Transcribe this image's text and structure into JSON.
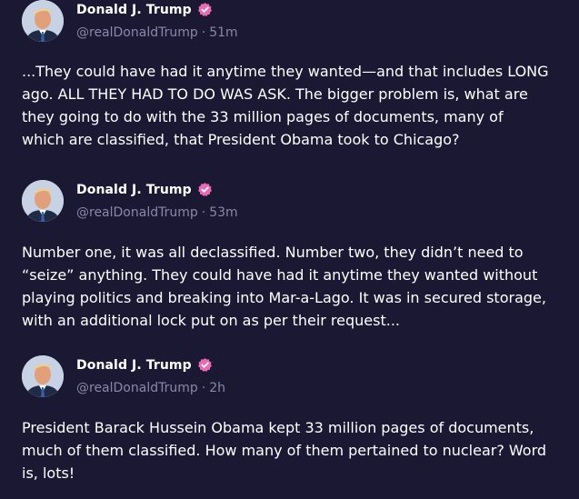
{
  "posts": [
    {
      "author": "Donald J. Trump",
      "handle": "@realDonaldTrump",
      "time": "51m",
      "verified_icon": "verified-badge-icon",
      "text": "...They could have had it anytime they wanted—and that includes LONG ago. ALL THEY HAD TO DO WAS ASK. The bigger problem is, what are they going to do with the 33 million pages of documents, many of which are classified, that President Obama took to Chicago?"
    },
    {
      "author": "Donald J. Trump",
      "handle": "@realDonaldTrump",
      "time": "53m",
      "verified_icon": "verified-badge-icon",
      "text": "Number one, it was all declassified. Number two, they didn’t need to “seize” anything. They could have had it anytime they wanted without playing politics and breaking into Mar-a-Lago. It was in secured storage, with an additional lock put on as per their request..."
    },
    {
      "author": "Donald J. Trump",
      "handle": "@realDonaldTrump",
      "time": "2h",
      "verified_icon": "verified-badge-icon",
      "text": "President Barack Hussein Obama kept 33 million pages of documents, much of them classified. How many of them pertained to nuclear? Word is, lots!"
    }
  ],
  "colors": {
    "background": "#1b1833",
    "badge": "#e86bb5",
    "meta_text": "#8a87a8"
  }
}
